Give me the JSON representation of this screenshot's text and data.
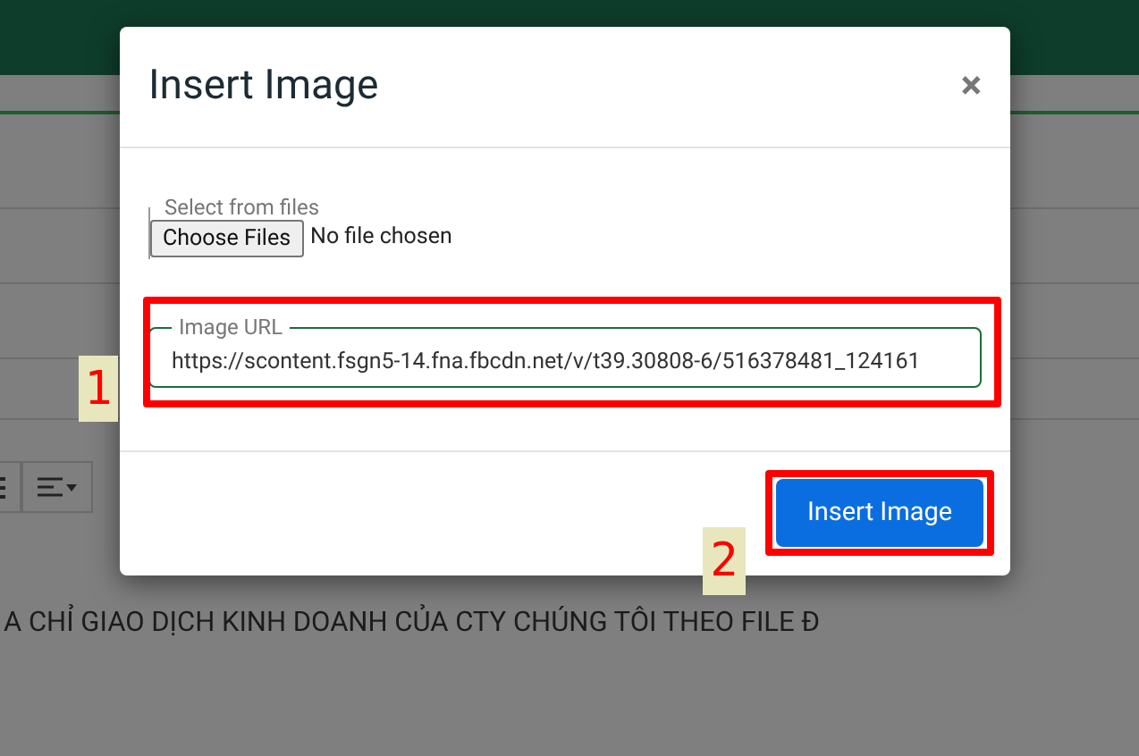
{
  "background": {
    "toolbar": [
      {
        "kind": "list"
      },
      {
        "kind": "align"
      }
    ],
    "content_text": "A CHỈ GIAO DỊCH KINH DOANH CỦA CTY CHÚNG TÔI THEO FILE Đ"
  },
  "dialog": {
    "title": "Insert Image",
    "close": "×",
    "file_field": {
      "legend": "Select from files",
      "button": "Choose Files",
      "status": "No file chosen"
    },
    "url_field": {
      "legend": "Image URL",
      "value": "https://scontent.fsgn5-14.fna.fbcdn.net/v/t39.30808-6/516378481_124161"
    },
    "submit": "Insert Image"
  },
  "annotations": [
    {
      "number": "1"
    },
    {
      "number": "2"
    }
  ]
}
